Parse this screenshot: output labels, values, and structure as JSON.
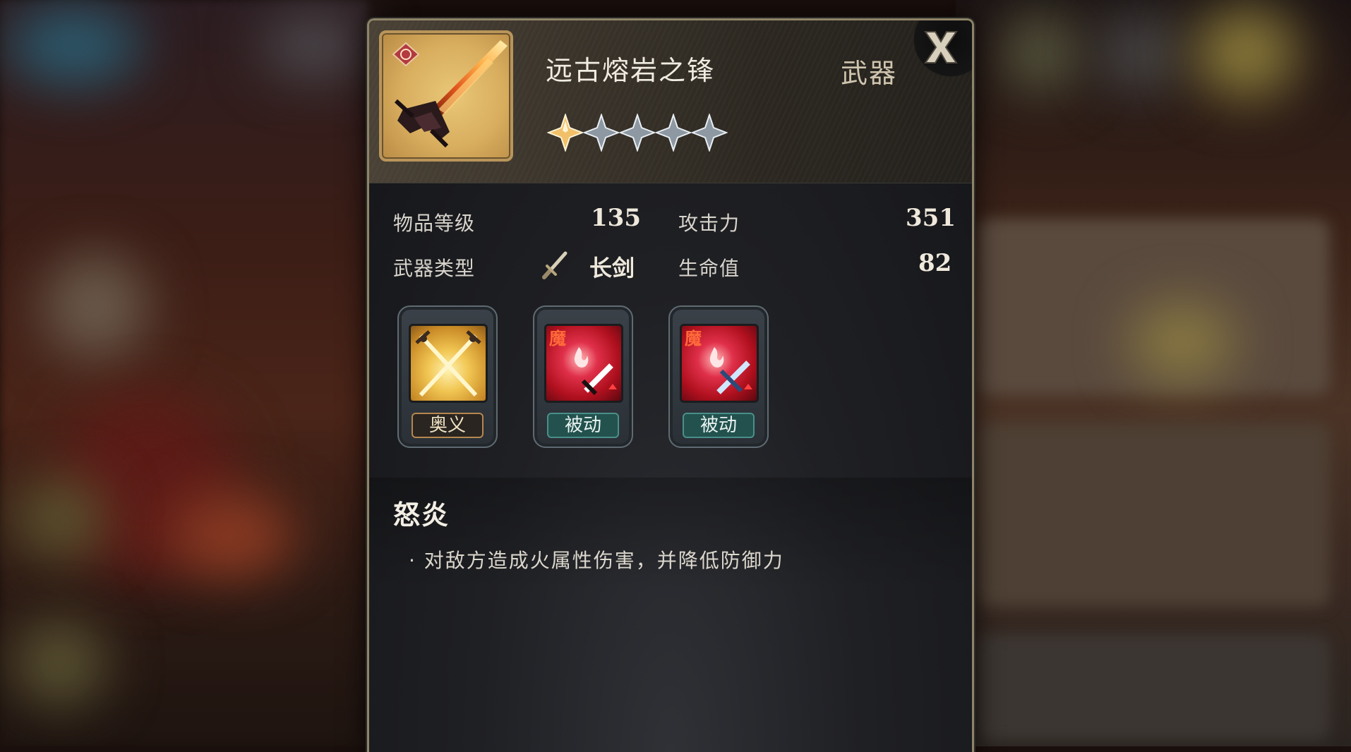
{
  "item": {
    "name": "远古熔岩之锋",
    "category": "武器",
    "icon": "lava-greatsword-icon",
    "element_badge": "fire-element-icon",
    "stars_total": 5,
    "stars_filled": 1
  },
  "stats": {
    "item_level_label": "物品等级",
    "item_level_value": "135",
    "attack_label": "攻击力",
    "attack_value": "351",
    "weapon_type_label": "武器类型",
    "weapon_type_icon": "longsword-icon",
    "weapon_type_value": "长剑",
    "hp_label": "生命值",
    "hp_value": "82"
  },
  "skills": [
    {
      "icon": "crossed-swords-icon",
      "tag": "奥义"
    },
    {
      "icon": "fire-sword-buff-icon",
      "tag": "被动",
      "badge": "魔"
    },
    {
      "icon": "fire-dagger-buff-icon",
      "tag": "被动",
      "badge": "魔"
    }
  ],
  "description": {
    "title": "怒炎",
    "line": "· 对敌方造成火属性伤害，并降低防御力"
  },
  "colors": {
    "accent_gold": "#b9955a",
    "tag_teal": "#23524e",
    "fire_red": "#c8182a"
  }
}
